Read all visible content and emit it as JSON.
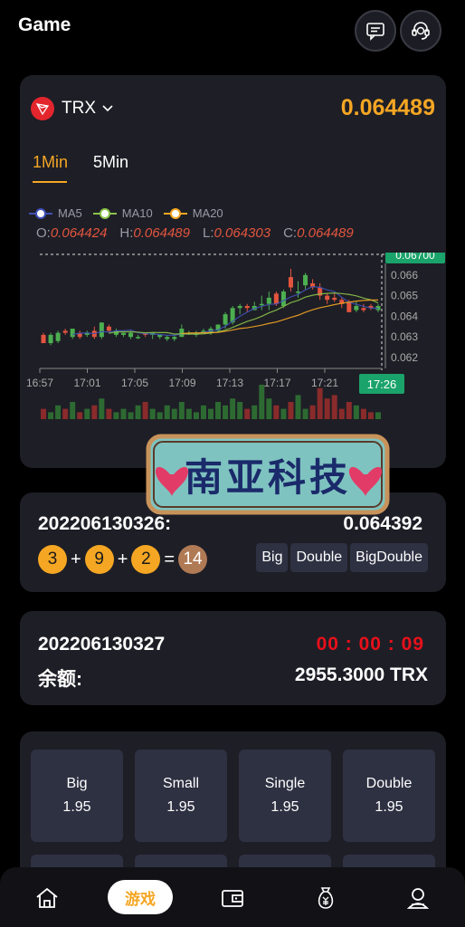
{
  "header": {
    "title": "Game",
    "message_icon": "message-icon",
    "service_icon": "customer-service-icon"
  },
  "market": {
    "coin": "TRX",
    "price": "0.064489",
    "tabs": [
      {
        "label": "1Min"
      },
      {
        "label": "5Min"
      }
    ],
    "ma_legend": [
      {
        "label": "MA5",
        "color": "#3f51b5"
      },
      {
        "label": "MA10",
        "color": "#8bc34a"
      },
      {
        "label": "MA20",
        "color": "#f5a623"
      }
    ],
    "ohlc": {
      "o_label": "O:",
      "o": "0.064424",
      "h_label": "H:",
      "h": "0.064489",
      "l_label": "L:",
      "l": "0.064303",
      "c_label": "C:",
      "c": "0.064489"
    }
  },
  "chart_data": {
    "type": "candlestick",
    "x_tick_labels": [
      "16:57",
      "17:01",
      "17:05",
      "17:09",
      "17:13",
      "17:17",
      "17:21"
    ],
    "y_tick_labels": [
      "0.066",
      "0.065",
      "0.064",
      "0.063",
      "0.062"
    ],
    "ylim": [
      0.062,
      0.067
    ],
    "max_price_label": "0.06700",
    "current_time_label": "17:26",
    "candles": [
      {
        "o": 0.0631,
        "c": 0.0627,
        "h": 0.0632,
        "l": 0.0627
      },
      {
        "o": 0.0627,
        "c": 0.0631,
        "h": 0.0632,
        "l": 0.0626
      },
      {
        "o": 0.0628,
        "c": 0.0632,
        "h": 0.0633,
        "l": 0.0627
      },
      {
        "o": 0.0633,
        "c": 0.0632,
        "h": 0.0634,
        "l": 0.0631
      },
      {
        "o": 0.063,
        "c": 0.0634,
        "h": 0.0634,
        "l": 0.0629
      },
      {
        "o": 0.0632,
        "c": 0.063,
        "h": 0.0633,
        "l": 0.0629
      },
      {
        "o": 0.0631,
        "c": 0.0632,
        "h": 0.0633,
        "l": 0.063
      },
      {
        "o": 0.0633,
        "c": 0.063,
        "h": 0.0635,
        "l": 0.0629
      },
      {
        "o": 0.063,
        "c": 0.0637,
        "h": 0.0637,
        "l": 0.0629
      },
      {
        "o": 0.0635,
        "c": 0.0633,
        "h": 0.0636,
        "l": 0.0632
      },
      {
        "o": 0.0631,
        "c": 0.0633,
        "h": 0.0634,
        "l": 0.063
      },
      {
        "o": 0.0631,
        "c": 0.0632,
        "h": 0.0632,
        "l": 0.063
      },
      {
        "o": 0.063,
        "c": 0.0632,
        "h": 0.0633,
        "l": 0.0629
      },
      {
        "o": 0.063,
        "c": 0.063,
        "h": 0.0631,
        "l": 0.0629
      },
      {
        "o": 0.0632,
        "c": 0.0631,
        "h": 0.0632,
        "l": 0.063
      },
      {
        "o": 0.0631,
        "c": 0.0632,
        "h": 0.0632,
        "l": 0.0629
      },
      {
        "o": 0.063,
        "c": 0.0631,
        "h": 0.0631,
        "l": 0.0629
      },
      {
        "o": 0.0629,
        "c": 0.063,
        "h": 0.0631,
        "l": 0.0628
      },
      {
        "o": 0.0629,
        "c": 0.063,
        "h": 0.0631,
        "l": 0.0628
      },
      {
        "o": 0.063,
        "c": 0.0634,
        "h": 0.0636,
        "l": 0.063
      },
      {
        "o": 0.0632,
        "c": 0.0632,
        "h": 0.0633,
        "l": 0.0631
      },
      {
        "o": 0.0631,
        "c": 0.0632,
        "h": 0.0633,
        "l": 0.063
      },
      {
        "o": 0.0632,
        "c": 0.0633,
        "h": 0.0634,
        "l": 0.0632
      },
      {
        "o": 0.0632,
        "c": 0.0634,
        "h": 0.0635,
        "l": 0.0631
      },
      {
        "o": 0.0633,
        "c": 0.0636,
        "h": 0.0636,
        "l": 0.0632
      },
      {
        "o": 0.0636,
        "c": 0.0641,
        "h": 0.0642,
        "l": 0.0634
      },
      {
        "o": 0.0637,
        "c": 0.0644,
        "h": 0.0645,
        "l": 0.0636
      },
      {
        "o": 0.0644,
        "c": 0.0645,
        "h": 0.0646,
        "l": 0.0641
      },
      {
        "o": 0.0645,
        "c": 0.0644,
        "h": 0.0646,
        "l": 0.0642
      },
      {
        "o": 0.0643,
        "c": 0.0645,
        "h": 0.0647,
        "l": 0.0643
      },
      {
        "o": 0.0646,
        "c": 0.0646,
        "h": 0.065,
        "l": 0.0643
      },
      {
        "o": 0.0646,
        "c": 0.0649,
        "h": 0.0652,
        "l": 0.0643
      },
      {
        "o": 0.0651,
        "c": 0.0646,
        "h": 0.0652,
        "l": 0.0645
      },
      {
        "o": 0.0645,
        "c": 0.0652,
        "h": 0.0653,
        "l": 0.0644
      },
      {
        "o": 0.0659,
        "c": 0.0654,
        "h": 0.0663,
        "l": 0.0652
      },
      {
        "o": 0.0652,
        "c": 0.0652,
        "h": 0.0657,
        "l": 0.0649
      },
      {
        "o": 0.0655,
        "c": 0.066,
        "h": 0.0661,
        "l": 0.0653
      },
      {
        "o": 0.0656,
        "c": 0.0654,
        "h": 0.0658,
        "l": 0.0653
      },
      {
        "o": 0.0654,
        "c": 0.065,
        "h": 0.0656,
        "l": 0.0648
      },
      {
        "o": 0.065,
        "c": 0.0648,
        "h": 0.0651,
        "l": 0.0646
      },
      {
        "o": 0.0649,
        "c": 0.0648,
        "h": 0.0651,
        "l": 0.0647
      },
      {
        "o": 0.0648,
        "c": 0.0646,
        "h": 0.0649,
        "l": 0.0644
      },
      {
        "o": 0.0647,
        "c": 0.0642,
        "h": 0.0648,
        "l": 0.0642
      },
      {
        "o": 0.0643,
        "c": 0.0645,
        "h": 0.0647,
        "l": 0.0642
      },
      {
        "o": 0.0644,
        "c": 0.0643,
        "h": 0.0646,
        "l": 0.0642
      },
      {
        "o": 0.0645,
        "c": 0.0644,
        "h": 0.0646,
        "l": 0.0643
      },
      {
        "o": 0.0643,
        "c": 0.0645,
        "h": 0.0646,
        "l": 0.0642
      }
    ],
    "volume": [
      0.3,
      0.2,
      0.4,
      0.3,
      0.5,
      0.2,
      0.3,
      0.4,
      0.6,
      0.3,
      0.2,
      0.3,
      0.2,
      0.4,
      0.5,
      0.3,
      0.2,
      0.4,
      0.3,
      0.5,
      0.3,
      0.2,
      0.4,
      0.3,
      0.5,
      0.4,
      0.6,
      0.5,
      0.3,
      0.4,
      1.0,
      0.6,
      0.4,
      0.3,
      0.5,
      0.7,
      0.3,
      0.4,
      0.9,
      0.6,
      0.7,
      0.3,
      0.5,
      0.4,
      0.3,
      0.2,
      0.2
    ]
  },
  "watermark": {
    "text": "南亚科技"
  },
  "last_draw": {
    "issue": "202206130326:",
    "price": "0.064392",
    "balls": [
      "3",
      "9",
      "2"
    ],
    "plus": "+",
    "equals": "=",
    "sum": "14",
    "tags": [
      "Big",
      "Double",
      "BigDouble"
    ]
  },
  "current": {
    "issue": "202206130327",
    "countdown": "00 : 00 : 09",
    "balance_label": "余额:",
    "balance_value": "2955.3000 TRX"
  },
  "bets": [
    {
      "label": "Big",
      "odds": "1.95"
    },
    {
      "label": "Small",
      "odds": "1.95"
    },
    {
      "label": "Single",
      "odds": "1.95"
    },
    {
      "label": "Double",
      "odds": "1.95"
    },
    {
      "label": "",
      "odds": ""
    },
    {
      "label": "",
      "odds": ""
    },
    {
      "label": "",
      "odds": ""
    },
    {
      "label": "",
      "odds": ""
    }
  ],
  "tabbar": {
    "game_label": "游戏",
    "icons": [
      "home-icon",
      "wallet-icon",
      "money-bag-icon",
      "profile-icon"
    ]
  },
  "colors": {
    "accent": "#f5a623",
    "up": "#4caf50",
    "down": "#e3553e",
    "countdown": "#e8101a",
    "card": "#1e1e26"
  }
}
